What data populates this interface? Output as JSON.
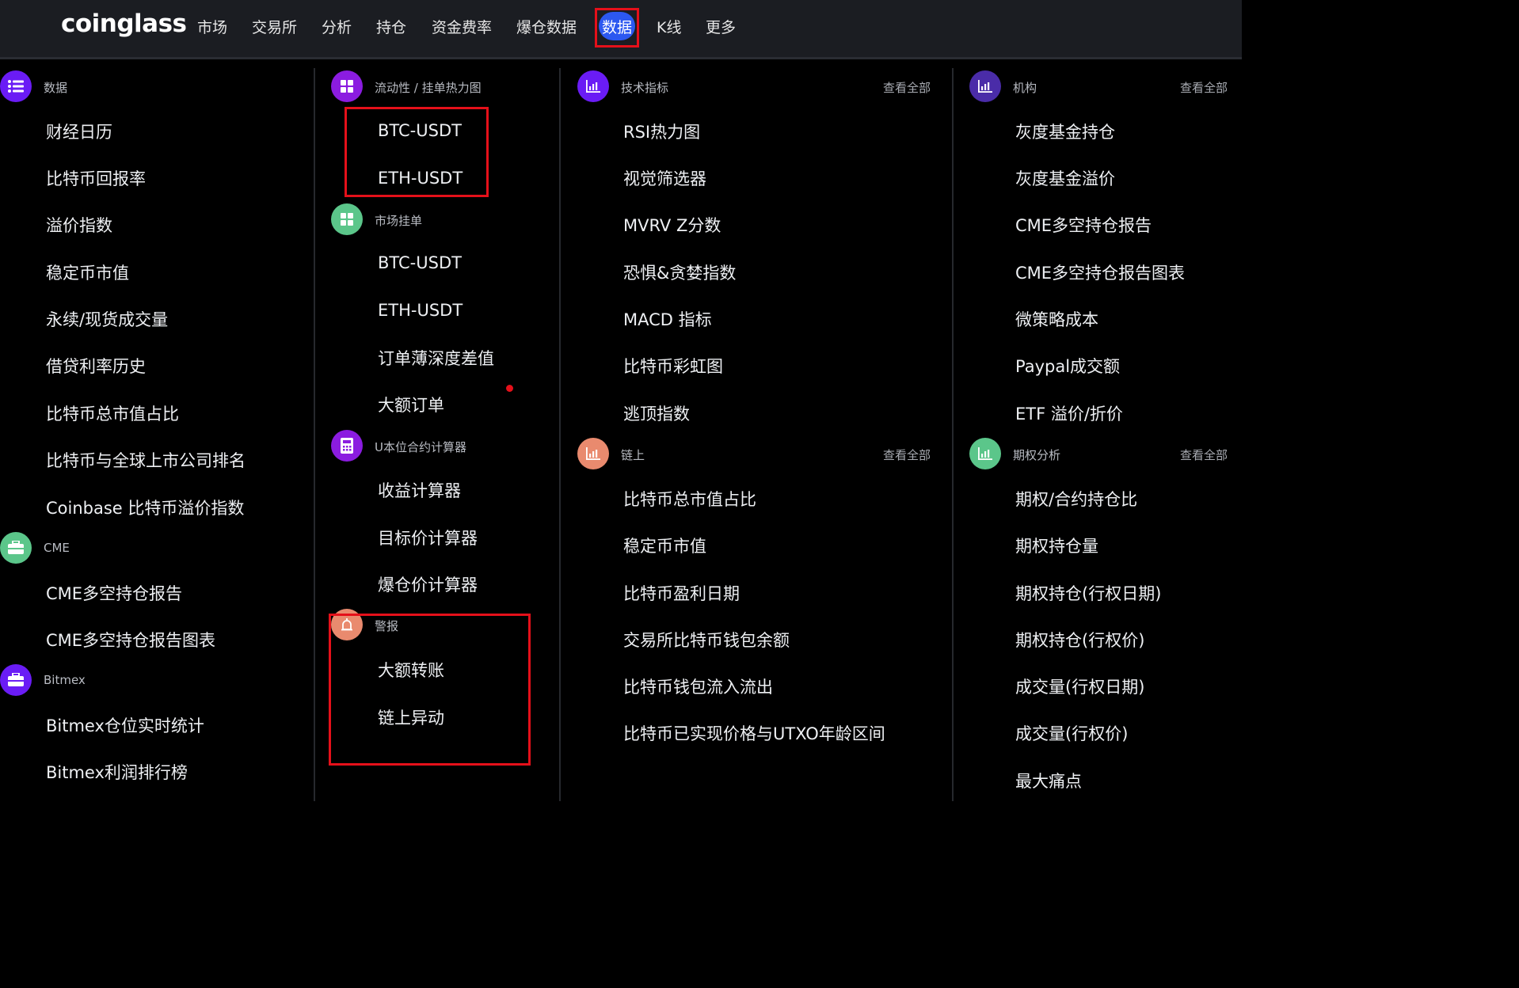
{
  "header": {
    "logo": "coinglass",
    "nav": [
      "市场",
      "交易所",
      "分析",
      "持仓",
      "资金费率",
      "爆仓数据",
      "数据",
      "K线",
      "更多"
    ],
    "active_nav": "数据"
  },
  "col1": {
    "data_title": "数据",
    "data_items": [
      "财经日历",
      "比特币回报率",
      "溢价指数",
      "稳定币市值",
      "永续/现货成交量",
      "借贷利率历史",
      "比特币总市值占比",
      "比特币与全球上市公司排名",
      "Coinbase 比特币溢价指数"
    ],
    "cme_title": "CME",
    "cme_items": [
      "CME多空持仓报告",
      "CME多空持仓报告图表"
    ],
    "bitmex_title": "Bitmex",
    "bitmex_items": [
      "Bitmex仓位实时统计",
      "Bitmex利润排行榜"
    ]
  },
  "col2": {
    "liq_title": "流动性 / 挂单热力图",
    "liq_items": [
      "BTC-USDT",
      "ETH-USDT"
    ],
    "market_title": "市场挂单",
    "market_items": [
      "BTC-USDT",
      "ETH-USDT",
      "订单薄深度差值",
      "大额订单"
    ],
    "calc_title": "U本位合约计算器",
    "calc_items": [
      "收益计算器",
      "目标价计算器",
      "爆仓价计算器"
    ],
    "alert_title": "警报",
    "alert_items": [
      "大额转账",
      "链上异动"
    ]
  },
  "col3": {
    "tech_title": "技术指标",
    "tech_see_all": "查看全部",
    "tech_items": [
      "RSI热力图",
      "视觉筛选器",
      "MVRV Z分数",
      "恐惧&贪婪指数",
      "MACD 指标",
      "比特币彩虹图",
      "逃顶指数"
    ],
    "chain_title": "链上",
    "chain_see_all": "查看全部",
    "chain_items": [
      "比特币总市值占比",
      "稳定币市值",
      "比特币盈利日期",
      "交易所比特币钱包余额",
      "比特币钱包流入流出",
      "比特币已实现价格与UTXO年龄区间"
    ]
  },
  "col4": {
    "inst_title": "机构",
    "inst_see_all": "查看全部",
    "inst_items": [
      "灰度基金持仓",
      "灰度基金溢价",
      "CME多空持仓报告",
      "CME多空持仓报告图表",
      "微策略成本",
      "Paypal成交额",
      "ETF 溢价/折价"
    ],
    "opt_title": "期权分析",
    "opt_see_all": "查看全部",
    "opt_items": [
      "期权/合约持仓比",
      "期权持仓量",
      "期权持仓(行权日期)",
      "期权持仓(行权价)",
      "成交量(行权日期)",
      "成交量(行权价)",
      "最大痛点"
    ]
  },
  "colors": {
    "accent": "#2c58f0",
    "highlight": "#e5101a",
    "purple": "#6a1cf5",
    "green": "#5bc68a",
    "salmon": "#e98a6e",
    "violet": "#8b1ce0",
    "indigo": "#4a2ca8"
  }
}
